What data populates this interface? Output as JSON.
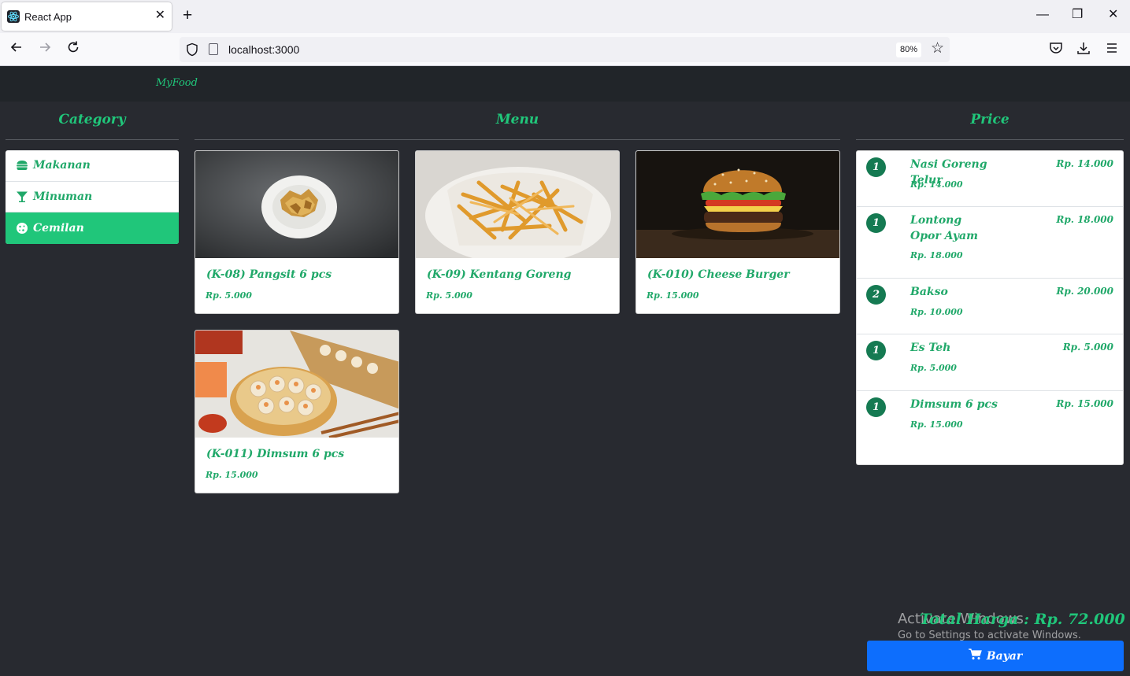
{
  "browser": {
    "tab_title": "React App",
    "tab_close": "✕",
    "new_tab": "+",
    "url": "localhost:3000",
    "zoom": "80%",
    "window_controls": [
      "—",
      "❐",
      "✕"
    ]
  },
  "app": {
    "brand": "MyFood",
    "accent_color": "#20c67a",
    "columns": {
      "category": "Category",
      "menu": "Menu",
      "price": "Price"
    }
  },
  "categories": [
    {
      "label": "Makanan",
      "icon": "hamburger-icon",
      "active": false
    },
    {
      "label": "Minuman",
      "icon": "cocktail-glass-icon",
      "active": false
    },
    {
      "label": "Cemilan",
      "icon": "cookie-icon",
      "active": true
    }
  ],
  "menu_items": [
    {
      "title": "(K-08) Pangsit 6 pcs",
      "price": "Rp. 5.000",
      "image": "fried-wonton-plate"
    },
    {
      "title": "(K-09) Kentang Goreng",
      "price": "Rp. 5.000",
      "image": "french-fries"
    },
    {
      "title": "(K-010) Cheese Burger",
      "price": "Rp. 15.000",
      "image": "cheese-burger"
    },
    {
      "title": "(K-011) Dimsum 6 pcs",
      "price": "Rp. 15.000",
      "image": "dimsum-steamer"
    }
  ],
  "orders": [
    {
      "qty": "1",
      "name": "Nasi Goreng Telur",
      "unit_price": "Rp. 14.000",
      "total": "Rp. 14.000"
    },
    {
      "qty": "1",
      "name": "Lontong Opor Ayam",
      "unit_price": "Rp. 18.000",
      "total": "Rp. 18.000"
    },
    {
      "qty": "2",
      "name": "Bakso",
      "unit_price": "Rp. 10.000",
      "total": "Rp. 20.000"
    },
    {
      "qty": "1",
      "name": "Es Teh",
      "unit_price": "Rp. 5.000",
      "total": "Rp. 5.000"
    },
    {
      "qty": "1",
      "name": "Dimsum 6 pcs",
      "unit_price": "Rp. 15.000",
      "total": "Rp. 15.000"
    }
  ],
  "summary": {
    "total_label": "Total Harga : Rp. 72.000",
    "pay_label": "Bayar"
  },
  "watermark": {
    "line1": "Activate Windows",
    "line2": "Go to Settings to activate Windows."
  }
}
